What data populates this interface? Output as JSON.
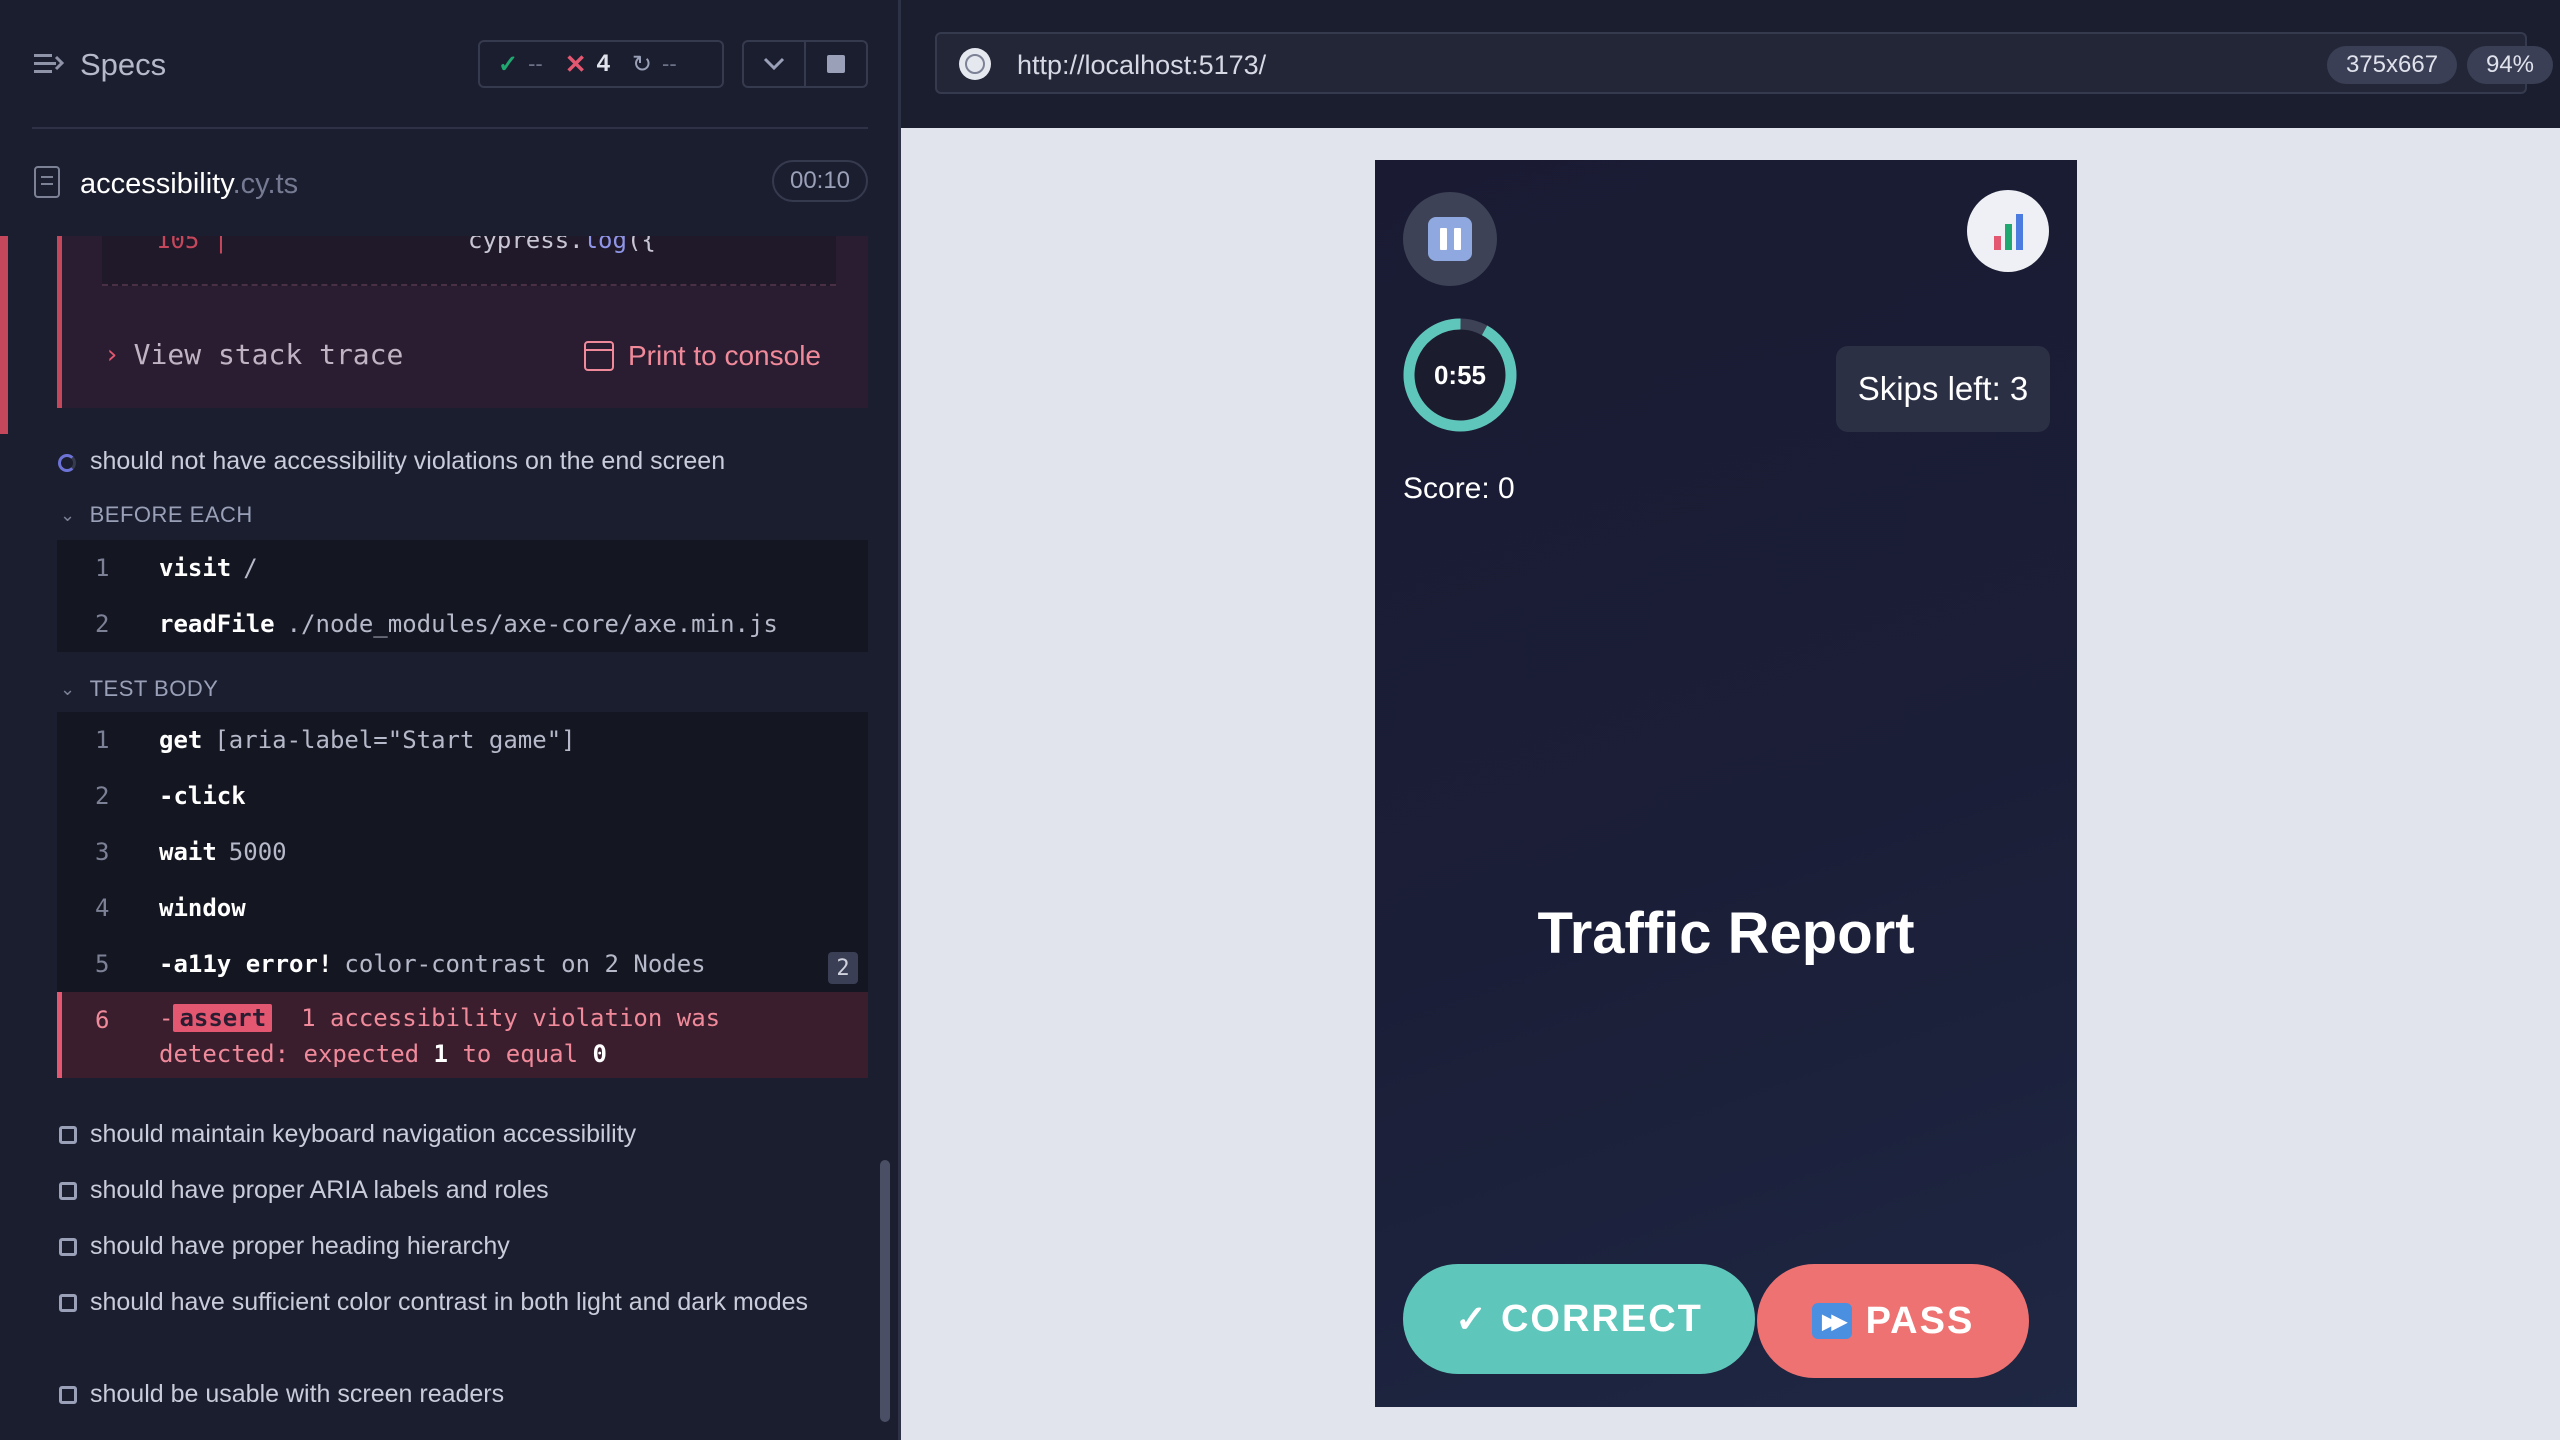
{
  "reporter": {
    "title": "Specs",
    "stats": {
      "passed": "--",
      "failed": "4",
      "pending": "--"
    },
    "file": {
      "name": "accessibility",
      "ext": ".cy.ts",
      "duration": "00:10"
    },
    "error": {
      "line_no": "105 |",
      "code_prefix": "cypress.",
      "code_fn": "log",
      "code_suffix": "({",
      "view_stack_trace": "View stack trace",
      "print_to_console": "Print to console"
    },
    "current_test": {
      "title": "should not have accessibility violations on the end screen",
      "before_each_label": "BEFORE EACH",
      "before_each": [
        {
          "num": "1",
          "cmd": "visit",
          "arg": "/"
        },
        {
          "num": "2",
          "cmd": "readFile",
          "arg": "./node_modules/axe-core/axe.min.js"
        }
      ],
      "test_body_label": "TEST BODY",
      "test_body": [
        {
          "num": "1",
          "cmd": "get",
          "arg": "[aria-label=\"Start game\"]"
        },
        {
          "num": "2",
          "cmd": "-click",
          "arg": ""
        },
        {
          "num": "3",
          "cmd": "wait",
          "arg": "5000"
        },
        {
          "num": "4",
          "cmd": "window",
          "arg": ""
        },
        {
          "num": "5",
          "cmd": "-a11y error!",
          "arg": "color-contrast on 2 Nodes",
          "badge": "2"
        }
      ],
      "failed_cmd": {
        "num": "6",
        "dash": "-",
        "tag": "assert",
        "msg1": "1 accessibility violation was",
        "msg2": "detected: expected",
        "v1": "1",
        "msg3": "to equal",
        "v2": "0"
      }
    },
    "pending_tests": [
      "should maintain keyboard navigation accessibility",
      "should have proper ARIA labels and roles",
      "should have proper heading hierarchy",
      "should have sufficient color contrast in both light and dark modes",
      "should be usable with screen readers"
    ]
  },
  "browser": {
    "url": "http://localhost:5173/",
    "viewport": "375x667",
    "zoom": "94%"
  },
  "app": {
    "timer": "0:55",
    "timer_fraction_elapsed": 0.08,
    "skips": "Skips left: 3",
    "score": "Score: 0",
    "word": "Traffic Report",
    "correct_icon": "✓",
    "correct_label": "CORRECT",
    "pass_label": "PASS"
  },
  "colors": {
    "accent_fail": "#e45770",
    "accent_pass": "#1fa971",
    "correct_btn": "#5fc6bb",
    "pass_btn": "#ee7272",
    "timer_ring": "#5fc6bb"
  }
}
